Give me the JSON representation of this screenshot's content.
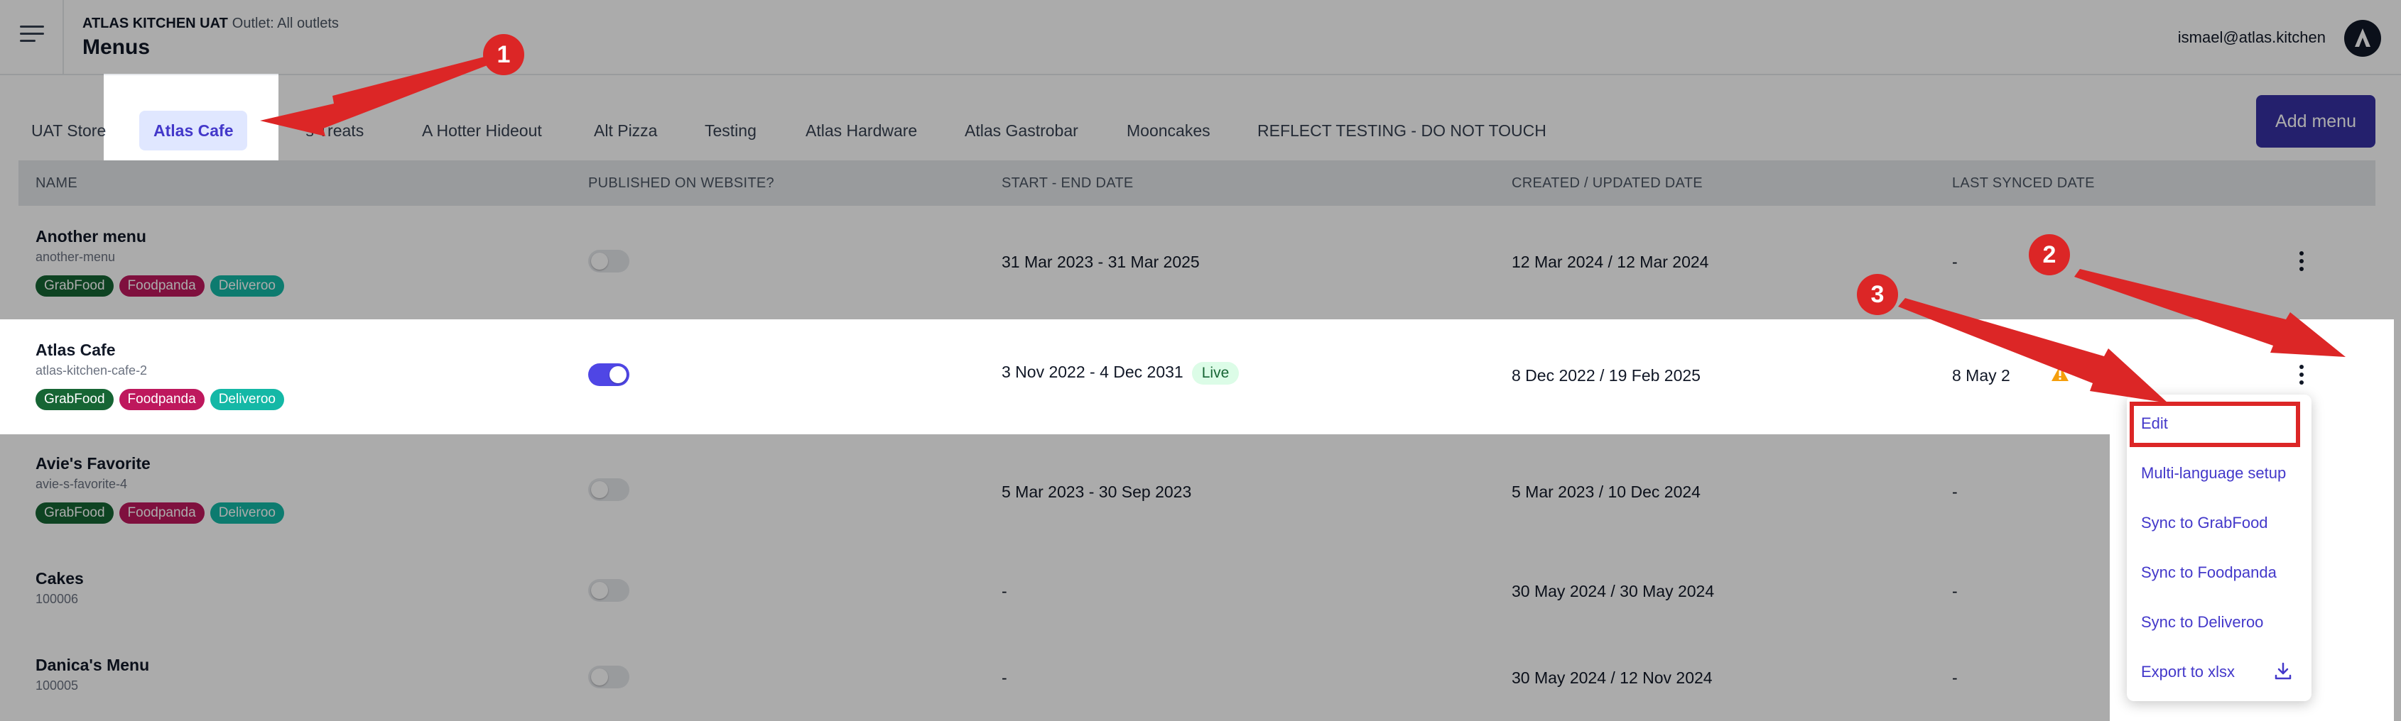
{
  "header": {
    "org_name": "ATLAS KITCHEN UAT",
    "outlet": "Outlet: All outlets",
    "title": "Menus",
    "user_email": "ismael@atlas.kitchen"
  },
  "tabs": [
    "UAT Store",
    "Atlas Cafe",
    "Avie's Treats",
    "A Hotter Hideout",
    "Alt Pizza",
    "Testing",
    "Atlas Hardware",
    "Atlas Gastrobar",
    "Mooncakes",
    "REFLECT TESTING - DO NOT TOUCH"
  ],
  "tabs_visible": [
    "UAT Store",
    "Atlas Cafe",
    "'s Treats",
    "A Hotter Hideout",
    "Alt Pizza",
    "Testing",
    "Atlas Hardware",
    "Atlas Gastrobar",
    "Mooncakes",
    "REFLECT TESTING - DO NOT TOUCH"
  ],
  "active_tab": "Atlas Cafe",
  "add_menu_label": "Add menu",
  "table": {
    "columns": [
      "NAME",
      "PUBLISHED ON WEBSITE?",
      "START - END DATE",
      "CREATED / UPDATED DATE",
      "LAST SYNCED DATE"
    ],
    "rows": [
      {
        "name": "Another menu",
        "slug": "another-menu",
        "tags": [
          "GrabFood",
          "Foodpanda",
          "Deliveroo"
        ],
        "published": false,
        "dates": "31 Mar 2023 - 31 Mar 2025",
        "live": "",
        "created_updated": "12 Mar 2024 / 12 Mar 2024",
        "last_synced": "-"
      },
      {
        "name": "Atlas Cafe",
        "slug": "atlas-kitchen-cafe-2",
        "tags": [
          "GrabFood",
          "Foodpanda",
          "Deliveroo"
        ],
        "published": true,
        "dates": "3 Nov 2022 - 4 Dec 2031",
        "live": "Live",
        "created_updated": "8 Dec 2022 / 19 Feb 2025",
        "last_synced": "8 May 2"
      },
      {
        "name": "Avie's Favorite",
        "slug": "avie-s-favorite-4",
        "tags": [
          "GrabFood",
          "Foodpanda",
          "Deliveroo"
        ],
        "published": false,
        "dates": "5 Mar 2023 - 30 Sep 2023",
        "live": "",
        "created_updated": "5 Mar 2023 / 10 Dec 2024",
        "last_synced": "-"
      },
      {
        "name": "Cakes",
        "slug": "100006",
        "tags": [],
        "published": false,
        "dates": "-",
        "live": "",
        "created_updated": "30 May 2024 / 30 May 2024",
        "last_synced": "-"
      },
      {
        "name": "Danica's Menu",
        "slug": "100005",
        "tags": [],
        "published": false,
        "dates": "-",
        "live": "",
        "created_updated": "30 May 2024 / 12 Nov 2024",
        "last_synced": "-"
      }
    ]
  },
  "dropdown": {
    "items": [
      "Edit",
      "Multi-language setup",
      "Sync to GrabFood",
      "Sync to Foodpanda",
      "Sync to Deliveroo",
      "Export to xlsx"
    ]
  },
  "annotations": [
    "1",
    "2",
    "3"
  ],
  "colors": {
    "accent": "#3730a3",
    "annotation": "#dc2626",
    "grabfood": "#166534",
    "foodpanda": "#be185d",
    "deliveroo": "#14b8a6"
  }
}
